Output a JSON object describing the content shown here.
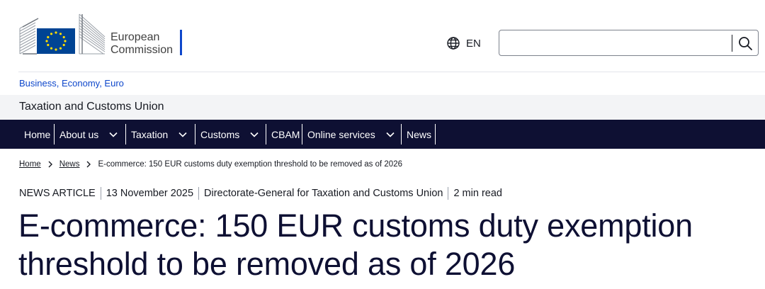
{
  "header": {
    "logo_line1": "European",
    "logo_line2": "Commission",
    "language": "EN",
    "language_icon": "globe-icon",
    "search_placeholder": "",
    "search_icon": "search-icon"
  },
  "site": {
    "parent_link": "Business, Economy, Euro",
    "title": "Taxation and Customs Union"
  },
  "nav": {
    "items": [
      {
        "label": "Home",
        "has_dropdown": false
      },
      {
        "label": "About us",
        "has_dropdown": true
      },
      {
        "label": "Taxation",
        "has_dropdown": true
      },
      {
        "label": "Customs",
        "has_dropdown": true
      },
      {
        "label": "CBAM",
        "has_dropdown": false
      },
      {
        "label": "Online services",
        "has_dropdown": true
      },
      {
        "label": "News",
        "has_dropdown": false
      }
    ]
  },
  "breadcrumb": {
    "items": [
      "Home",
      "News"
    ],
    "current": "E-commerce: 150 EUR customs duty exemption threshold to be removed as of 2026"
  },
  "article": {
    "type": "NEWS ARTICLE",
    "date": "13 November 2025",
    "department": "Directorate-General for Taxation and Customs Union",
    "read_time": "2 min read",
    "title": "E-commerce: 150 EUR customs duty exemption threshold to be removed as of 2026"
  },
  "colors": {
    "nav_bg": "#0e1033",
    "link_blue": "#0e47cb",
    "eu_blue": "#004494",
    "eu_yellow": "#ffdd00",
    "band_bg": "#f3f4f6"
  }
}
